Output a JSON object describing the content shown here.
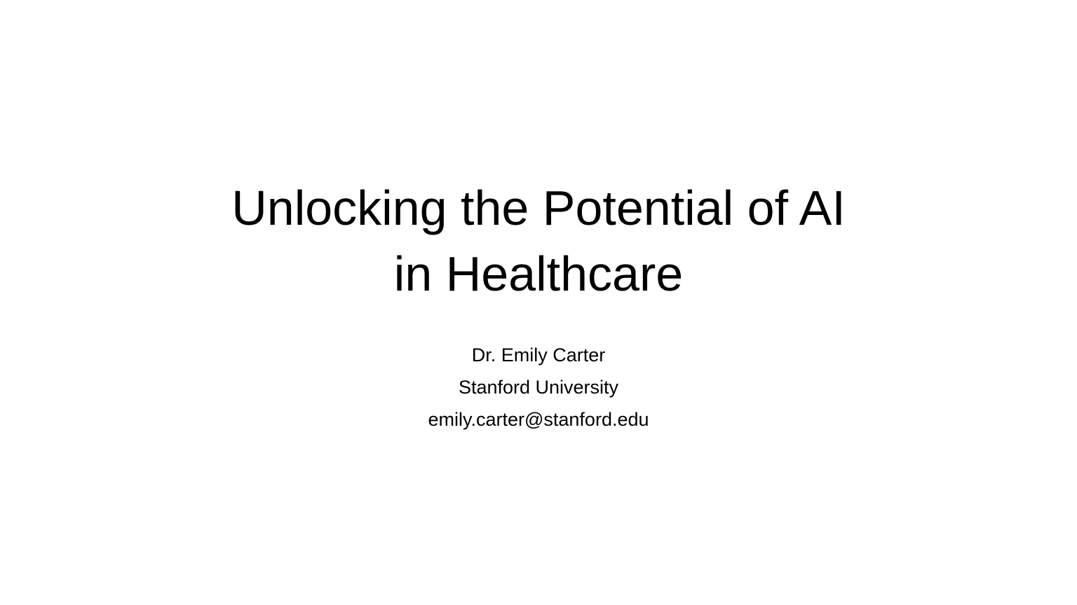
{
  "slide": {
    "title_lines": [
      "Unlocking the Potential of AI",
      "in Healthcare"
    ],
    "subtitle_lines": [
      "Dr. Emily Carter",
      "Stanford University",
      "emily.carter@stanford.edu"
    ]
  }
}
